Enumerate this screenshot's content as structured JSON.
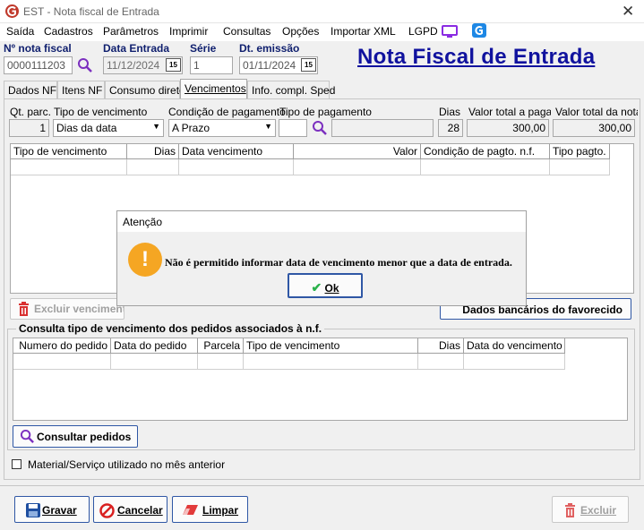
{
  "window": {
    "title": "EST - Nota fiscal de Entrada",
    "close_glyph": "✕"
  },
  "menu": [
    "Saída",
    "Cadastros",
    "Parâmetros",
    "Imprimir",
    "Consultas",
    "Opções",
    "Importar XML",
    "LGPD"
  ],
  "header": {
    "nota_label": "Nº nota fiscal",
    "nota_value": "0000111203",
    "data_entrada_label": "Data Entrada",
    "data_entrada_value": "11/12/2024",
    "serie_label": "Série",
    "serie_value": "1",
    "dt_emissao_label": "Dt. emissão",
    "dt_emissao_value": "01/11/2024",
    "cal_glyph": "15",
    "big_title": "Nota Fiscal de Entrada"
  },
  "tabs": [
    "Dados NF",
    "Itens NF",
    "Consumo direto",
    "Vencimentos",
    "Info. compl. Sped"
  ],
  "vencimentos": {
    "qt_parc_label": "Qt. parc.",
    "qt_parc_value": "1",
    "tipo_venc_label": "Tipo de vencimento",
    "tipo_venc_value": "Dias da data",
    "cond_pag_label": "Condição de pagamento",
    "cond_pag_value": "A Prazo",
    "tipo_pag_label": "Tipo de pagamento",
    "tipo_pag_value": "",
    "dias_label": "Dias",
    "dias_value": "28",
    "valor_pagar_label": "Valor total a pagar",
    "valor_pagar_value": "300,00",
    "valor_nota_label": "Valor total da nota",
    "valor_nota_value": "300,00",
    "grid_headers": [
      "Tipo de vencimento",
      "Dias",
      "Data vencimento",
      "Valor",
      "Condição de pagto. n.f.",
      "Tipo pagto."
    ],
    "excluir_label": "Excluir vencimento",
    "favorecido_label": "Dados bancários do favorecido"
  },
  "pedidos": {
    "section_title": "Consulta tipo de vencimento dos pedidos associados à n.f.",
    "grid_headers": [
      "Numero do pedido",
      "Data do pedido",
      "Parcela",
      "Tipo de vencimento",
      "Dias",
      "Data do vencimento"
    ],
    "consultar_label": "Consultar pedidos"
  },
  "checkbox": {
    "label": "Material/Serviço utilizado no mês anterior",
    "checked": false
  },
  "footer": {
    "gravar": "Gravar",
    "cancelar": "Cancelar",
    "limpar": "Limpar",
    "excluir": "Excluir"
  },
  "dialog": {
    "title": "Atenção",
    "message": "Não é permitido informar data de vencimento menor que a data de entrada.",
    "ok_label": "Ok",
    "icon_glyph": "!"
  },
  "colors": {
    "accent": "#10129e",
    "label_blue": "#0f1f6e",
    "warning": "#f5a623",
    "button_border": "#2f57a5"
  }
}
